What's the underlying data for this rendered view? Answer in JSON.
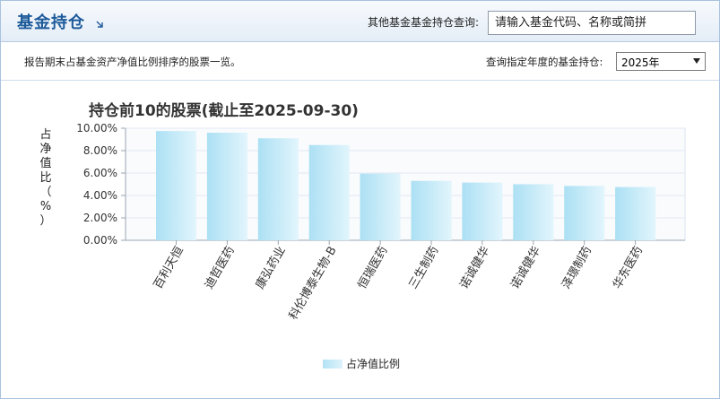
{
  "header": {
    "title": "基金持仓",
    "other_query_label": "其他基金基金持仓查询:",
    "search_placeholder": "请输入基金代码、名称或简拼"
  },
  "toolbar": {
    "description": "报告期末占基金资产净值比例排序的股票一览。",
    "year_label": "查询指定年度的基金持仓:",
    "year_value": "2025年"
  },
  "chart_data": {
    "type": "bar",
    "title": "持仓前10的股票(截止至2025-09-30)",
    "ylabel": "占净值比（%）",
    "ylim": [
      0,
      10
    ],
    "yticks": [
      "0.00%",
      "2.00%",
      "4.00%",
      "6.00%",
      "8.00%",
      "10.00%"
    ],
    "categories": [
      "百利天恒",
      "迪哲医药",
      "康弘药业",
      "科伦博泰生物-B",
      "恒瑞医药",
      "三生制药",
      "诺诚健华",
      "诺诚健华",
      "泽璟制药",
      "华东医药"
    ],
    "series": [
      {
        "name": "占净值比例",
        "values": [
          9.75,
          9.6,
          9.1,
          8.5,
          5.95,
          5.3,
          5.15,
          5.0,
          4.85,
          4.75
        ]
      }
    ],
    "legend": "bottom",
    "grid": true,
    "bar_color": "#bfe8f7"
  }
}
